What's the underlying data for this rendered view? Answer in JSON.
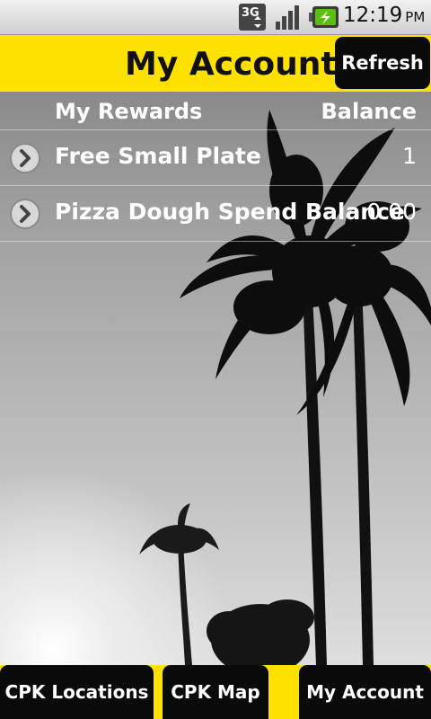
{
  "status_bar": {
    "network": "3G",
    "time": "12:19",
    "ampm": "PM"
  },
  "header": {
    "title": "My Account",
    "refresh_label": "Refresh"
  },
  "rewards": {
    "col_rewards": "My Rewards",
    "col_balance": "Balance",
    "items": [
      {
        "name": "Free Small Plate",
        "value": "1"
      },
      {
        "name": "Pizza Dough Spend Balance",
        "value": "0.00"
      }
    ]
  },
  "tabs": [
    {
      "label": "CPK Locations"
    },
    {
      "label": "CPK Map"
    },
    {
      "label": "My Account"
    }
  ],
  "colors": {
    "accent": "#ffe100",
    "button": "#0a0a0a"
  }
}
